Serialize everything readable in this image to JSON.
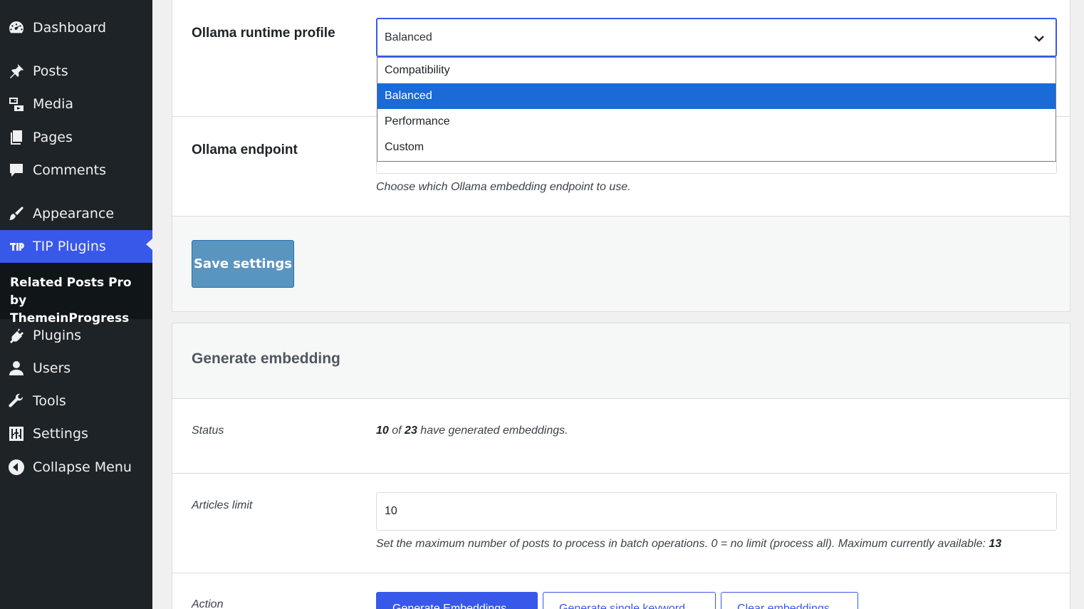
{
  "sidebar": {
    "items": [
      {
        "label": "Dashboard",
        "icon": "dashboard-icon"
      },
      {
        "label": "Posts",
        "icon": "pin-icon"
      },
      {
        "label": "Media",
        "icon": "media-icon"
      },
      {
        "label": "Pages",
        "icon": "pages-icon"
      },
      {
        "label": "Comments",
        "icon": "comment-icon"
      },
      {
        "label": "Appearance",
        "icon": "brush-icon"
      },
      {
        "label": "TIP Plugins",
        "icon": "tip-logo-icon"
      },
      {
        "label": "Plugins",
        "icon": "plug-icon"
      },
      {
        "label": "Users",
        "icon": "user-icon"
      },
      {
        "label": "Tools",
        "icon": "wrench-icon"
      },
      {
        "label": "Settings",
        "icon": "sliders-icon"
      },
      {
        "label": "Collapse Menu",
        "icon": "collapse-arrow-icon"
      }
    ],
    "submenu_label": "Related Posts Pro by ThemeinProgress",
    "active_color": "#3858e9"
  },
  "settings": {
    "runtime_profile": {
      "label": "Ollama runtime profile",
      "selected": "Balanced",
      "options": [
        "Compatibility",
        "Balanced",
        "Performance",
        "Custom"
      ]
    },
    "endpoint": {
      "label": "Ollama endpoint",
      "description": "Choose which Ollama embedding endpoint to use."
    },
    "save_label": "Save settings"
  },
  "embedding": {
    "title": "Generate embedding",
    "status": {
      "label": "Status",
      "done": "10",
      "of": "of",
      "total": "23",
      "suffix": "have generated embeddings."
    },
    "articles_limit": {
      "label": "Articles limit",
      "value": "10",
      "description": "Set the maximum number of posts to process in batch operations. 0 = no limit (process all). Maximum currently available:",
      "max_available": "13"
    },
    "action": {
      "label": "Action",
      "buttons": [
        "Generate Embeddings",
        "Generate single keyword",
        "Clear embeddings"
      ]
    }
  }
}
